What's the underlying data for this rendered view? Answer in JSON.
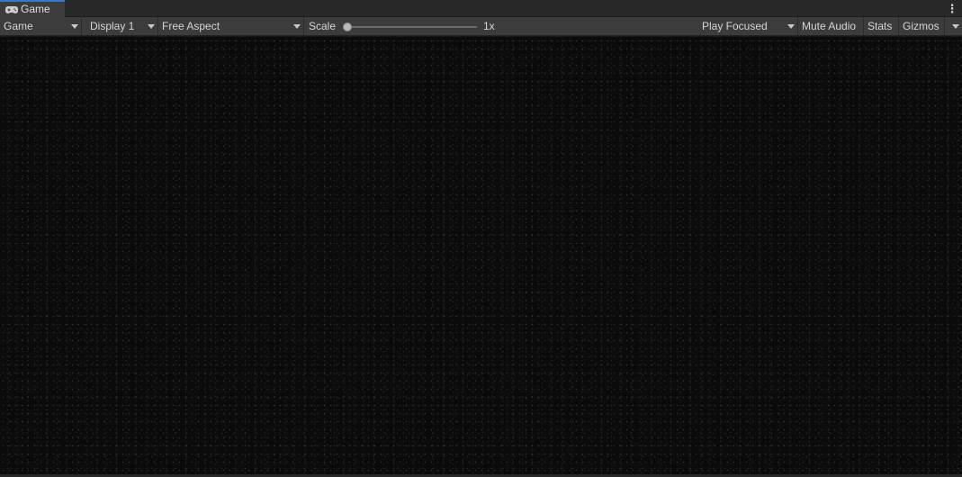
{
  "tab": {
    "label": "Game",
    "icon": "gamepad-icon"
  },
  "menu": {
    "icon": "kebab-menu-icon",
    "glyph": "⋮"
  },
  "toolbar": {
    "view_mode": "Game",
    "display": "Display 1",
    "aspect": "Free Aspect",
    "scale_label": "Scale",
    "scale_value": "1x",
    "scale_level": 0.0,
    "play_mode": "Play Focused",
    "mute_audio": "Mute Audio",
    "stats": "Stats",
    "gizmos": "Gizmos"
  },
  "colors": {
    "accent": "#3a79bb",
    "toolbar_bg": "#3c3c3c",
    "viewport_bg": "#0b0b0b"
  }
}
